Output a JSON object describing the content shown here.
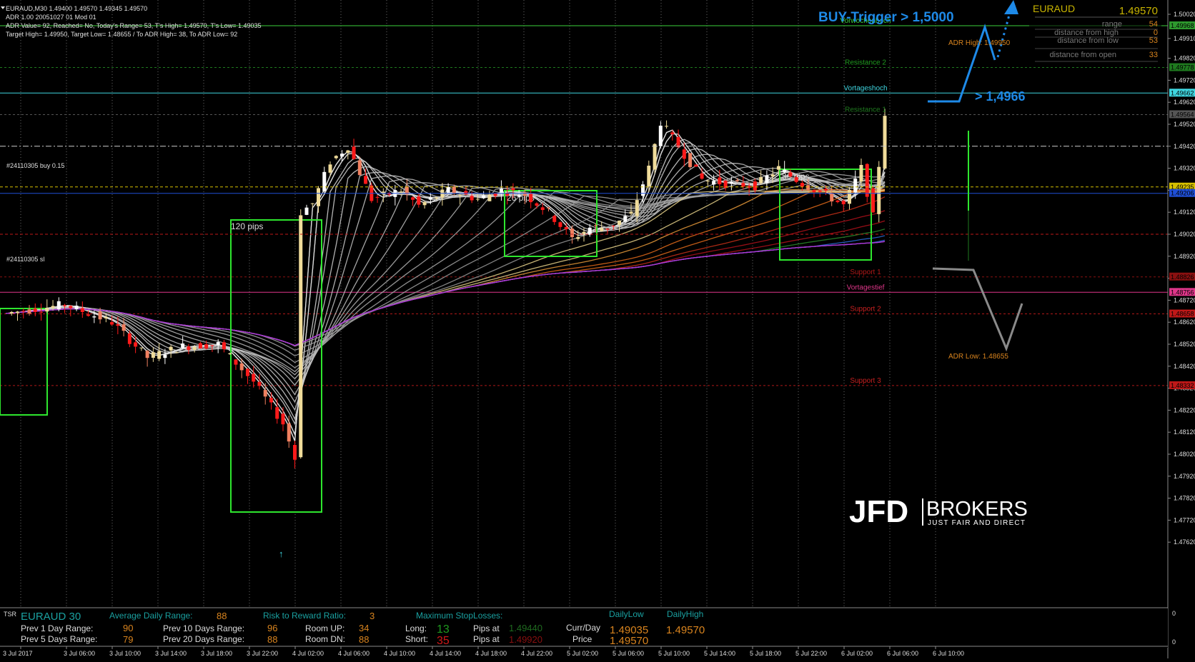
{
  "header": {
    "symbol_line": "EURAUD,M30  1.49400 1.49570 1.49345 1.49570",
    "adr_line": "ADR 1.00 20051027 01 Mod 01",
    "adr_values_line": "ADR Value= 92, Reached= No, Today's Range= 53, T's High= 1.49570, T's Low= 1.49035",
    "target_line": "Target High= 1.49950, Target Low= 1.48655 / To ADR High= 38, To ADR Low= 92"
  },
  "info_panel": {
    "symbol": "EURAUD",
    "price": "1.49570",
    "rows": [
      {
        "label": "range",
        "value": "54"
      },
      {
        "label": "distance from high",
        "value": "0"
      },
      {
        "label": "distance from low",
        "value": "53"
      },
      {
        "label": "distance from open",
        "value": "33"
      }
    ]
  },
  "annotations": {
    "buy_trigger": "BUY-Trigger > 1,5000",
    "level_note": "> 1,4966",
    "box_120": "120 pips",
    "box_26": "26 pips",
    "box_36": "36 pips",
    "order_buy": "#24110305 buy 0.15",
    "order_sl": "#24110305 sl",
    "adr_high": "ADR High: 1.49950",
    "adr_low": "ADR Low: 1.48655"
  },
  "levels": [
    {
      "name": "Vorwochenhoch",
      "price": 1.49968,
      "color": "#3bd13b",
      "label_color": "#3bd13b",
      "style": "solid"
    },
    {
      "name": "Resistance 2",
      "price": 1.49778,
      "color": "#1f7a1f",
      "label_color": "#1f9a1f",
      "style": "dash"
    },
    {
      "name": "Vortageshoch",
      "price": 1.49662,
      "color": "#3fd6e0",
      "label_color": "#3fd6e0",
      "style": "solid"
    },
    {
      "name": "Resistance 1",
      "price": 1.49564,
      "color": "#555555",
      "label_color": "#1f7a1f",
      "style": "dash"
    },
    {
      "name": "Support 1",
      "price": 1.48826,
      "color": "#8a1010",
      "label_color": "#b01818",
      "style": "dash"
    },
    {
      "name": "Vortagestief",
      "price": 1.48756,
      "color": "#e0368a",
      "label_color": "#e0368a",
      "style": "solid"
    },
    {
      "name": "Support 2",
      "price": 1.48658,
      "color": "#b01818",
      "label_color": "#c82020",
      "style": "dash"
    },
    {
      "name": "Support 3",
      "price": 1.48332,
      "color": "#b01818",
      "label_color": "#c82020",
      "style": "dash"
    }
  ],
  "logo": {
    "left": "JFD",
    "right": "BROKERS",
    "tagline": "JUST FAIR AND DIRECT"
  },
  "chart_data": {
    "type": "candlestick",
    "symbol": "EURAUD",
    "timeframe": "M30",
    "ylim": [
      1.4762,
      1.5002
    ],
    "y_ticks": [
      "1.50020",
      "1.49910",
      "1.49820",
      "1.49720",
      "1.49620",
      "1.49520",
      "1.49420",
      "1.49320",
      "1.49220",
      "1.49120",
      "1.49020",
      "1.48920",
      "1.48820",
      "1.48720",
      "1.48620",
      "1.48520",
      "1.48420",
      "1.48320",
      "1.48220",
      "1.48120",
      "1.48020",
      "1.47920",
      "1.47820",
      "1.47720",
      "1.47620"
    ],
    "price_tags": [
      {
        "value": "1.49968",
        "price": 1.49968,
        "bg": "#2e9a2e"
      },
      {
        "value": "1.49778",
        "price": 1.49778,
        "bg": "#1f7a1f"
      },
      {
        "value": "1.49662",
        "price": 1.49662,
        "bg": "#3fd6e0"
      },
      {
        "value": "1.49564",
        "price": 1.49564,
        "bg": "#555555"
      },
      {
        "value": "1.49235",
        "price": 1.49235,
        "bg": "#d6c000"
      },
      {
        "value": "1.49206",
        "price": 1.49206,
        "bg": "#1f4fd6"
      },
      {
        "value": "1.48826",
        "price": 1.48826,
        "bg": "#8a1010"
      },
      {
        "value": "1.48756",
        "price": 1.48756,
        "bg": "#e0368a"
      },
      {
        "value": "1.48658",
        "price": 1.48658,
        "bg": "#c01818"
      },
      {
        "value": "1.48332",
        "price": 1.48332,
        "bg": "#c01818"
      }
    ],
    "x_labels": [
      "3 Jul 2017",
      "3 Jul 06:00",
      "3 Jul 10:00",
      "3 Jul 14:00",
      "3 Jul 18:00",
      "3 Jul 22:00",
      "4 Jul 02:00",
      "4 Jul 06:00",
      "4 Jul 10:00",
      "4 Jul 14:00",
      "4 Jul 18:00",
      "4 Jul 22:00",
      "5 Jul 02:00",
      "5 Jul 06:00",
      "5 Jul 10:00",
      "5 Jul 14:00",
      "5 Jul 18:00",
      "5 Jul 22:00",
      "6 Jul 02:00",
      "6 Jul 06:00",
      "6 Jul 10:00"
    ],
    "anchors": [
      {
        "i": 0,
        "p": 1.4866
      },
      {
        "i": 10,
        "p": 1.487
      },
      {
        "i": 18,
        "p": 1.4862
      },
      {
        "i": 24,
        "p": 1.4846
      },
      {
        "i": 30,
        "p": 1.4851
      },
      {
        "i": 36,
        "p": 1.4852
      },
      {
        "i": 42,
        "p": 1.4835
      },
      {
        "i": 47,
        "p": 1.4816
      },
      {
        "i": 49,
        "p": 1.48
      },
      {
        "i": 50,
        "p": 1.4912
      },
      {
        "i": 52,
        "p": 1.4916
      },
      {
        "i": 55,
        "p": 1.4935
      },
      {
        "i": 58,
        "p": 1.4942
      },
      {
        "i": 62,
        "p": 1.4918
      },
      {
        "i": 67,
        "p": 1.4922
      },
      {
        "i": 70,
        "p": 1.4915
      },
      {
        "i": 75,
        "p": 1.4922
      },
      {
        "i": 80,
        "p": 1.4918
      },
      {
        "i": 84,
        "p": 1.4922
      },
      {
        "i": 88,
        "p": 1.492
      },
      {
        "i": 92,
        "p": 1.4912
      },
      {
        "i": 96,
        "p": 1.49
      },
      {
        "i": 99,
        "p": 1.4905
      },
      {
        "i": 102,
        "p": 1.4905
      },
      {
        "i": 106,
        "p": 1.4911
      },
      {
        "i": 109,
        "p": 1.4932
      },
      {
        "i": 111,
        "p": 1.4953
      },
      {
        "i": 114,
        "p": 1.4942
      },
      {
        "i": 118,
        "p": 1.4927
      },
      {
        "i": 122,
        "p": 1.4925
      },
      {
        "i": 127,
        "p": 1.4924
      },
      {
        "i": 131,
        "p": 1.4932
      },
      {
        "i": 135,
        "p": 1.4925
      },
      {
        "i": 139,
        "p": 1.492
      },
      {
        "i": 142,
        "p": 1.4915
      },
      {
        "i": 145,
        "p": 1.4932
      },
      {
        "i": 147,
        "p": 1.491
      },
      {
        "i": 149,
        "p": 1.4957
      }
    ],
    "candle_count": 150
  },
  "trade_lines": [
    {
      "name": "order-buy-line",
      "price": 1.4942,
      "color": "#cccccc",
      "style": "dashdot"
    },
    {
      "name": "current-yellow-line",
      "price": 1.49235,
      "color": "#d6c000",
      "style": "dash"
    },
    {
      "name": "blue-line",
      "price": 1.49206,
      "color": "#1f4fd6",
      "style": "solid"
    },
    {
      "name": "order-sl-line",
      "price": 1.4902,
      "color": "#c01818",
      "style": "dash"
    }
  ],
  "bottom_panel": {
    "tsr": "TSR",
    "symbol": "EURAUD 30",
    "adr_label": "Average Daily Range:",
    "adr_value": "88",
    "rr_label": "Risk to Reward Ratio:",
    "rr_value": "3",
    "maxsl_label": "Maximum StopLosses:",
    "dailylow_label": "DailyLow",
    "dailyhigh_label": "DailyHigh",
    "prev1_label": "Prev 1 Day Range:",
    "prev1_value": "90",
    "prev10_label": "Prev 10 Days Range:",
    "prev10_value": "96",
    "roomup_label": "Room UP:",
    "roomup_value": "34",
    "long_label": "Long:",
    "long_value": "13",
    "pips_at_label": "Pips at",
    "long_pips": "1.49440",
    "currday_label": "Curr/Day",
    "dailylow_value": "1.49035",
    "dailyhigh_value": "1.49570",
    "prev5_label": "Prev 5 Days Range:",
    "prev5_value": "79",
    "prev20_label": "Prev 20 Days Range:",
    "prev20_value": "88",
    "roomdn_label": "Room DN:",
    "roomdn_value": "88",
    "short_label": "Short:",
    "short_value": "35",
    "short_pips": "1.49920",
    "price_label": "Price",
    "price_value": "1.49570",
    "scale_top": "0",
    "scale_bottom": "0"
  }
}
